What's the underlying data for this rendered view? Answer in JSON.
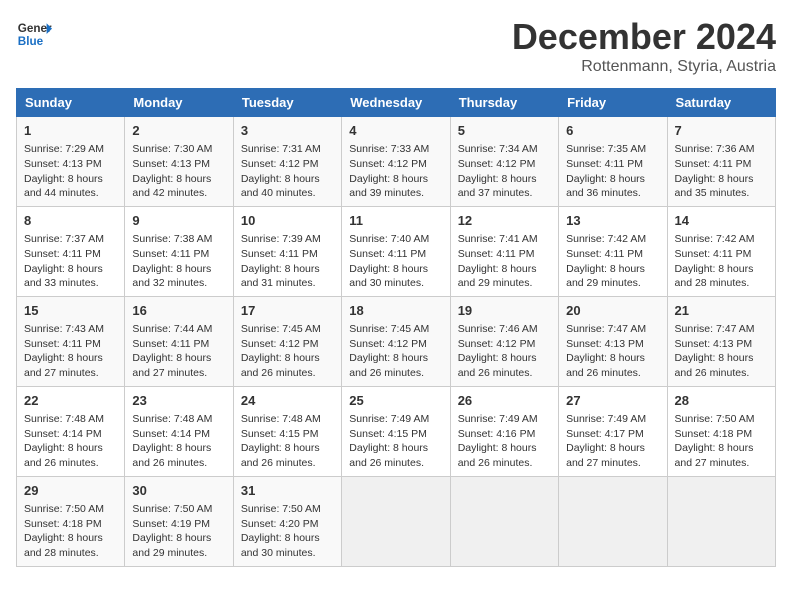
{
  "header": {
    "logo_general": "General",
    "logo_blue": "Blue",
    "title": "December 2024",
    "subtitle": "Rottenmann, Styria, Austria"
  },
  "weekdays": [
    "Sunday",
    "Monday",
    "Tuesday",
    "Wednesday",
    "Thursday",
    "Friday",
    "Saturday"
  ],
  "weeks": [
    [
      {
        "day": "1",
        "sunrise": "Sunrise: 7:29 AM",
        "sunset": "Sunset: 4:13 PM",
        "daylight": "Daylight: 8 hours and 44 minutes."
      },
      {
        "day": "2",
        "sunrise": "Sunrise: 7:30 AM",
        "sunset": "Sunset: 4:13 PM",
        "daylight": "Daylight: 8 hours and 42 minutes."
      },
      {
        "day": "3",
        "sunrise": "Sunrise: 7:31 AM",
        "sunset": "Sunset: 4:12 PM",
        "daylight": "Daylight: 8 hours and 40 minutes."
      },
      {
        "day": "4",
        "sunrise": "Sunrise: 7:33 AM",
        "sunset": "Sunset: 4:12 PM",
        "daylight": "Daylight: 8 hours and 39 minutes."
      },
      {
        "day": "5",
        "sunrise": "Sunrise: 7:34 AM",
        "sunset": "Sunset: 4:12 PM",
        "daylight": "Daylight: 8 hours and 37 minutes."
      },
      {
        "day": "6",
        "sunrise": "Sunrise: 7:35 AM",
        "sunset": "Sunset: 4:11 PM",
        "daylight": "Daylight: 8 hours and 36 minutes."
      },
      {
        "day": "7",
        "sunrise": "Sunrise: 7:36 AM",
        "sunset": "Sunset: 4:11 PM",
        "daylight": "Daylight: 8 hours and 35 minutes."
      }
    ],
    [
      {
        "day": "8",
        "sunrise": "Sunrise: 7:37 AM",
        "sunset": "Sunset: 4:11 PM",
        "daylight": "Daylight: 8 hours and 33 minutes."
      },
      {
        "day": "9",
        "sunrise": "Sunrise: 7:38 AM",
        "sunset": "Sunset: 4:11 PM",
        "daylight": "Daylight: 8 hours and 32 minutes."
      },
      {
        "day": "10",
        "sunrise": "Sunrise: 7:39 AM",
        "sunset": "Sunset: 4:11 PM",
        "daylight": "Daylight: 8 hours and 31 minutes."
      },
      {
        "day": "11",
        "sunrise": "Sunrise: 7:40 AM",
        "sunset": "Sunset: 4:11 PM",
        "daylight": "Daylight: 8 hours and 30 minutes."
      },
      {
        "day": "12",
        "sunrise": "Sunrise: 7:41 AM",
        "sunset": "Sunset: 4:11 PM",
        "daylight": "Daylight: 8 hours and 29 minutes."
      },
      {
        "day": "13",
        "sunrise": "Sunrise: 7:42 AM",
        "sunset": "Sunset: 4:11 PM",
        "daylight": "Daylight: 8 hours and 29 minutes."
      },
      {
        "day": "14",
        "sunrise": "Sunrise: 7:42 AM",
        "sunset": "Sunset: 4:11 PM",
        "daylight": "Daylight: 8 hours and 28 minutes."
      }
    ],
    [
      {
        "day": "15",
        "sunrise": "Sunrise: 7:43 AM",
        "sunset": "Sunset: 4:11 PM",
        "daylight": "Daylight: 8 hours and 27 minutes."
      },
      {
        "day": "16",
        "sunrise": "Sunrise: 7:44 AM",
        "sunset": "Sunset: 4:11 PM",
        "daylight": "Daylight: 8 hours and 27 minutes."
      },
      {
        "day": "17",
        "sunrise": "Sunrise: 7:45 AM",
        "sunset": "Sunset: 4:12 PM",
        "daylight": "Daylight: 8 hours and 26 minutes."
      },
      {
        "day": "18",
        "sunrise": "Sunrise: 7:45 AM",
        "sunset": "Sunset: 4:12 PM",
        "daylight": "Daylight: 8 hours and 26 minutes."
      },
      {
        "day": "19",
        "sunrise": "Sunrise: 7:46 AM",
        "sunset": "Sunset: 4:12 PM",
        "daylight": "Daylight: 8 hours and 26 minutes."
      },
      {
        "day": "20",
        "sunrise": "Sunrise: 7:47 AM",
        "sunset": "Sunset: 4:13 PM",
        "daylight": "Daylight: 8 hours and 26 minutes."
      },
      {
        "day": "21",
        "sunrise": "Sunrise: 7:47 AM",
        "sunset": "Sunset: 4:13 PM",
        "daylight": "Daylight: 8 hours and 26 minutes."
      }
    ],
    [
      {
        "day": "22",
        "sunrise": "Sunrise: 7:48 AM",
        "sunset": "Sunset: 4:14 PM",
        "daylight": "Daylight: 8 hours and 26 minutes."
      },
      {
        "day": "23",
        "sunrise": "Sunrise: 7:48 AM",
        "sunset": "Sunset: 4:14 PM",
        "daylight": "Daylight: 8 hours and 26 minutes."
      },
      {
        "day": "24",
        "sunrise": "Sunrise: 7:48 AM",
        "sunset": "Sunset: 4:15 PM",
        "daylight": "Daylight: 8 hours and 26 minutes."
      },
      {
        "day": "25",
        "sunrise": "Sunrise: 7:49 AM",
        "sunset": "Sunset: 4:15 PM",
        "daylight": "Daylight: 8 hours and 26 minutes."
      },
      {
        "day": "26",
        "sunrise": "Sunrise: 7:49 AM",
        "sunset": "Sunset: 4:16 PM",
        "daylight": "Daylight: 8 hours and 26 minutes."
      },
      {
        "day": "27",
        "sunrise": "Sunrise: 7:49 AM",
        "sunset": "Sunset: 4:17 PM",
        "daylight": "Daylight: 8 hours and 27 minutes."
      },
      {
        "day": "28",
        "sunrise": "Sunrise: 7:50 AM",
        "sunset": "Sunset: 4:18 PM",
        "daylight": "Daylight: 8 hours and 27 minutes."
      }
    ],
    [
      {
        "day": "29",
        "sunrise": "Sunrise: 7:50 AM",
        "sunset": "Sunset: 4:18 PM",
        "daylight": "Daylight: 8 hours and 28 minutes."
      },
      {
        "day": "30",
        "sunrise": "Sunrise: 7:50 AM",
        "sunset": "Sunset: 4:19 PM",
        "daylight": "Daylight: 8 hours and 29 minutes."
      },
      {
        "day": "31",
        "sunrise": "Sunrise: 7:50 AM",
        "sunset": "Sunset: 4:20 PM",
        "daylight": "Daylight: 8 hours and 30 minutes."
      },
      null,
      null,
      null,
      null
    ]
  ]
}
